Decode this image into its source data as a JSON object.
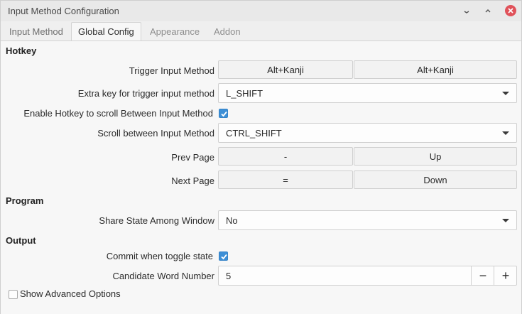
{
  "window": {
    "title": "Input Method Configuration"
  },
  "tabs": [
    {
      "label": "Input Method"
    },
    {
      "label": "Global Config"
    },
    {
      "label": "Appearance"
    },
    {
      "label": "Addon"
    }
  ],
  "hotkey": {
    "section": "Hotkey",
    "trigger": {
      "label": "Trigger Input Method",
      "key1": "Alt+Kanji",
      "key2": "Alt+Kanji"
    },
    "extra": {
      "label": "Extra key for trigger input method",
      "value": "L_SHIFT"
    },
    "enable_scroll": {
      "label": "Enable Hotkey to scroll Between Input Method",
      "checked": true
    },
    "scroll": {
      "label": "Scroll between Input Method",
      "value": "CTRL_SHIFT"
    },
    "prev": {
      "label": "Prev Page",
      "key1": "-",
      "key2": "Up"
    },
    "next": {
      "label": "Next Page",
      "key1": "=",
      "key2": "Down"
    }
  },
  "program": {
    "section": "Program",
    "share": {
      "label": "Share State Among Window",
      "value": "No"
    }
  },
  "output": {
    "section": "Output",
    "commit": {
      "label": "Commit when toggle state",
      "checked": true
    },
    "candidate": {
      "label": "Candidate Word Number",
      "value": "5",
      "minus": "−",
      "plus": "+"
    }
  },
  "advanced": {
    "label": "Show Advanced Options",
    "checked": false
  },
  "colors": {
    "accent": "#3d8fd6",
    "close": "#e0525a"
  }
}
